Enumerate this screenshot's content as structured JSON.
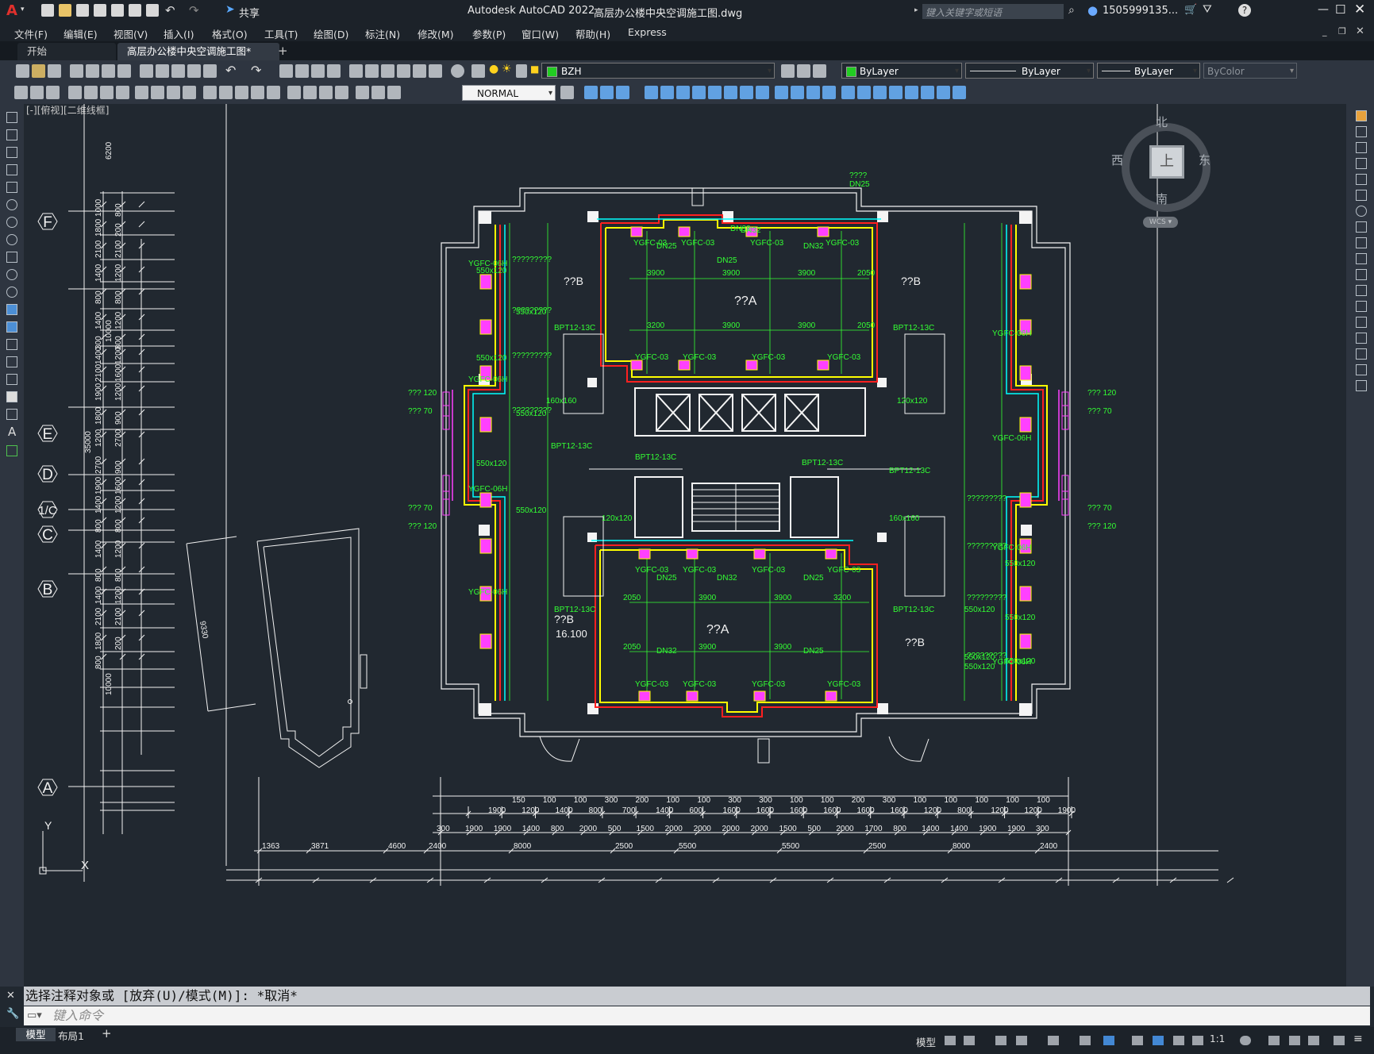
{
  "titlebar": {
    "app_title": "Autodesk AutoCAD 2022",
    "file_title": "高层办公楼中央空调施工图.dwg",
    "share": "共享",
    "search_placeholder": "键入关键字或短语",
    "user": "1505999135...",
    "logo": "A"
  },
  "menu": [
    "文件(F)",
    "编辑(E)",
    "视图(V)",
    "插入(I)",
    "格式(O)",
    "工具(T)",
    "绘图(D)",
    "标注(N)",
    "修改(M)",
    "参数(P)",
    "窗口(W)",
    "帮助(H)",
    "Express"
  ],
  "tabs": {
    "start": "开始",
    "doc": "高层办公楼中央空调施工图*",
    "add": "+"
  },
  "toolbar": {
    "layer": "BZH",
    "color": "ByLayer",
    "linetype": "ByLayer",
    "lineweight": "ByLayer",
    "plotstyle": "ByColor",
    "dimstyle": "NORMAL",
    "layer_color": "#22cc22"
  },
  "viewport": {
    "label": "[-][俯视][二维线框]"
  },
  "viewcube": {
    "north": "北",
    "south": "南",
    "east": "东",
    "west": "西",
    "top": "上",
    "wcs": "WCS"
  },
  "ucs": {
    "x": "X",
    "y": "Y"
  },
  "grid_bubbles": [
    "F",
    "E",
    "D",
    "1/C",
    "C",
    "B",
    "A"
  ],
  "left_dims": {
    "outer": [
      "6200",
      "35000",
      "10000",
      "10000"
    ],
    "mid": [
      "1000",
      "1800",
      "2100",
      "1400",
      "800",
      "1400",
      "300",
      "1400",
      "2100",
      "1900",
      "1800",
      "1200",
      "2700",
      "1900",
      "1400",
      "800",
      "1400",
      "800",
      "1400",
      "2100",
      "1800",
      "800"
    ],
    "inner": [
      "800",
      "200",
      "2100",
      "1200",
      "800",
      "1200",
      "800",
      "1200",
      "1600",
      "1200",
      "900",
      "2700",
      "900",
      "1600",
      "1200",
      "800",
      "1200",
      "800",
      "1200",
      "2100",
      "200"
    ]
  },
  "slope_dim": "9330",
  "plan": {
    "rooms": [
      "??A",
      "??A",
      "??B",
      "??B",
      "??B",
      "??B"
    ],
    "units_top": [
      "YGFC-03",
      "YGFC-03",
      "YGFC-03",
      "YGFC-03"
    ],
    "units_mid": [
      "YGFC-03",
      "YGFC-03",
      "YGFC-03",
      "YGFC-03"
    ],
    "units_bot1": [
      "YGFC-03",
      "YGFC-03",
      "YGFC-03",
      "YGFC-03"
    ],
    "units_bot2": [
      "YGFC-03",
      "YGFC-03",
      "YGFC-03",
      "YGFC-03"
    ],
    "side_units": [
      "YGFC-06H",
      "YGFC-06H",
      "YGFC-06H",
      "YGFC-06H",
      "YGFC-06H",
      "YGFC-06H",
      "YGFC-06H",
      "YGFC-06H"
    ],
    "ducts": [
      "550x120",
      "550x120",
      "550x120",
      "550x120",
      "550x120",
      "550x120",
      "550x120",
      "550x120",
      "550x120",
      "550x120",
      "550x120",
      "550x120"
    ],
    "qmarks": [
      "?????????",
      "?????????",
      "?????????",
      "?????????",
      "?????????",
      "?????????",
      "?????????",
      "?????????"
    ],
    "pipes": [
      "DN32",
      "DN25",
      "DN25",
      "DN32",
      "DN25",
      "DN32",
      "DN25",
      "DN32",
      "DN25"
    ],
    "dims_top": [
      "3900",
      "3900",
      "3900",
      "2050"
    ],
    "dims_mid": [
      "3200",
      "3900",
      "3900",
      "2050"
    ],
    "dims_bot1": [
      "2050",
      "3900",
      "3900",
      "3200"
    ],
    "dims_bot2": [
      "2050",
      "3900",
      "3900"
    ],
    "bpt": [
      "BPT12-13C",
      "BPT12-13C",
      "BPT12-13C",
      "BPT12-13C",
      "BPT12-13C",
      "BPT12-13C",
      "BPT12-13C",
      "BPT12-13C"
    ],
    "small": [
      "??? 120",
      "??? 70",
      "??? 120",
      "??? 70",
      "??? 120",
      "??? 70",
      "??? 120",
      "??? 70",
      "????",
      "DN25",
      "DN32"
    ],
    "elev": "16.100",
    "vents": [
      "160x160",
      "120x120",
      "120x120",
      "160x160"
    ]
  },
  "bottom_dims": {
    "row1": [
      "1900",
      "1200",
      "1400",
      "800",
      "700",
      "1400",
      "600",
      "1600",
      "1600",
      "1600",
      "1600",
      "1600",
      "1600",
      "1200",
      "800",
      "1200",
      "1200",
      "1900"
    ],
    "row2": [
      "300",
      "1900",
      "1900",
      "1400",
      "800",
      "2000",
      "500",
      "1500",
      "2000",
      "2000",
      "2000",
      "2000",
      "1500",
      "500",
      "2000",
      "1700",
      "800",
      "1400",
      "1400",
      "1900",
      "1900",
      "300"
    ],
    "row3": [
      "1363",
      "3871",
      "4600",
      "2400",
      "8000",
      "2500",
      "5500",
      "5500",
      "2500",
      "8000",
      "2400"
    ],
    "top": [
      "150",
      "100",
      "100",
      "300",
      "200",
      "100",
      "100",
      "300",
      "300",
      "100",
      "100",
      "200",
      "300",
      "100",
      "100",
      "100",
      "100",
      "100"
    ]
  },
  "command": {
    "history": "选择注释对象或 [放弃(U)/模式(M)]: *取消*",
    "placeholder": "键入命令"
  },
  "status": {
    "model_tab": "模型",
    "layout_tab": "布局1",
    "model": "模型",
    "scale": "1:1"
  }
}
